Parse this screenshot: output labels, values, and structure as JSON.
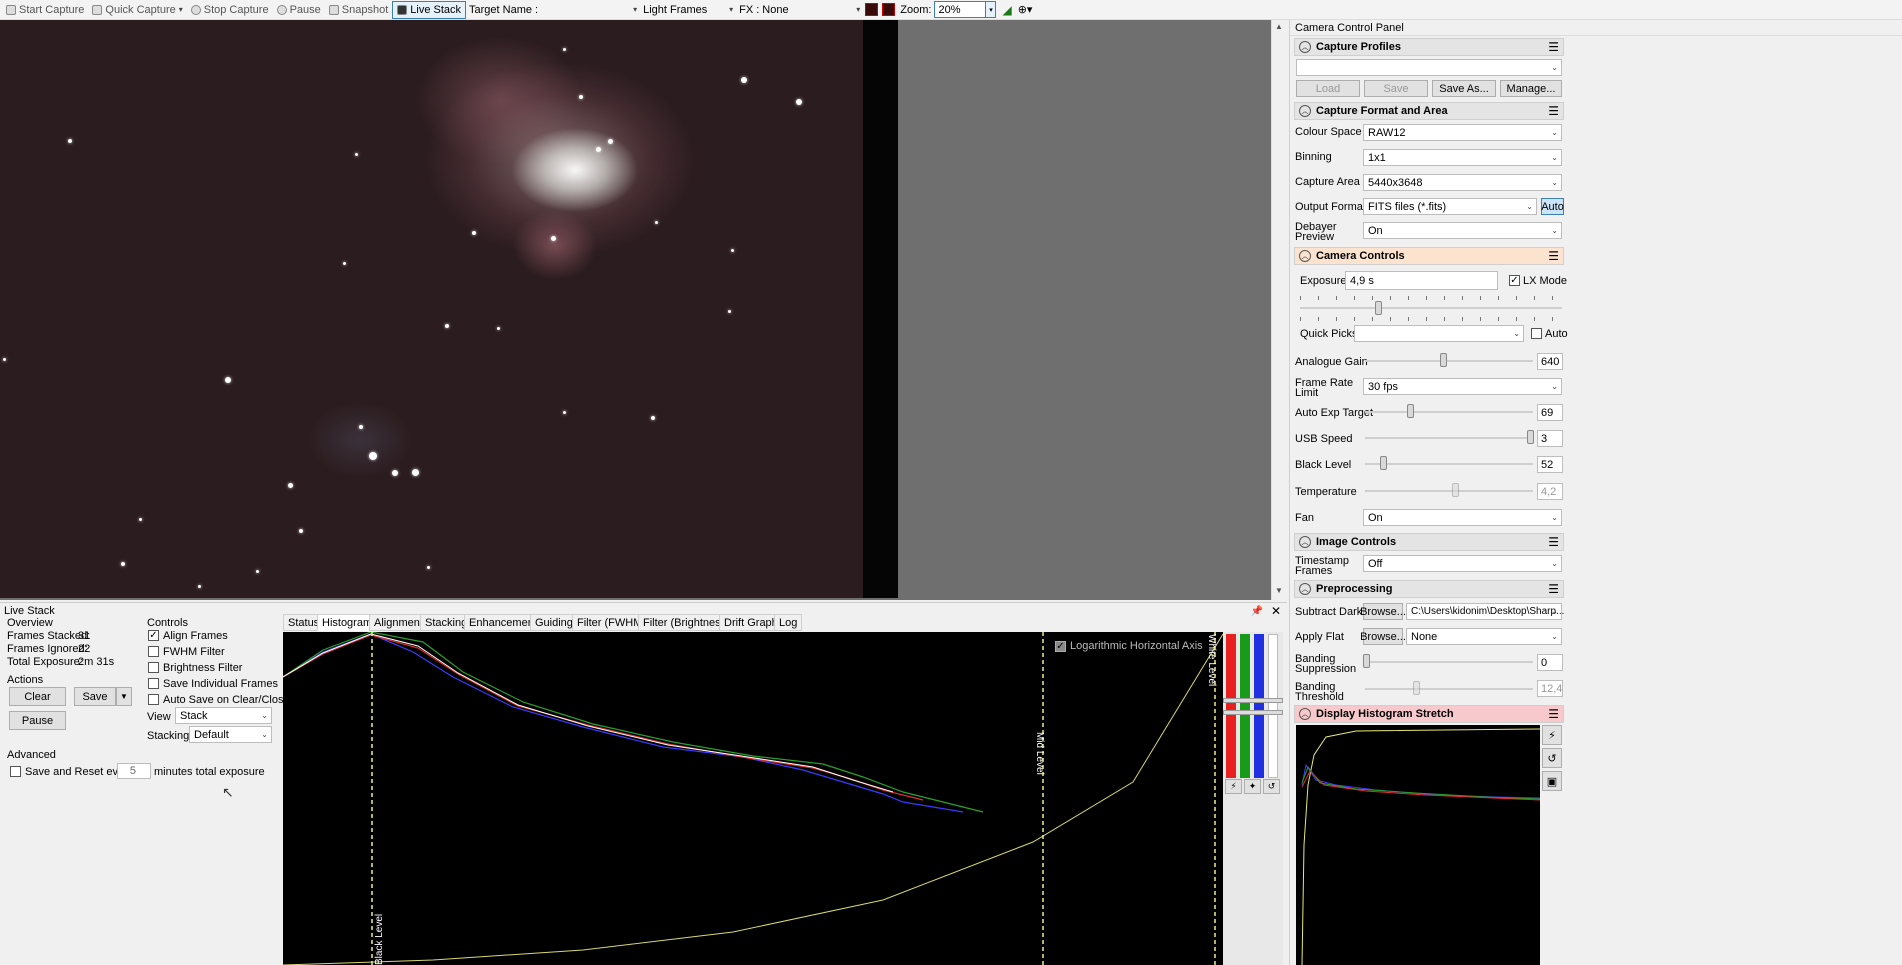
{
  "toolbar": {
    "start_capture": "Start Capture",
    "quick_capture": "Quick Capture",
    "stop_capture": "Stop Capture",
    "pause": "Pause",
    "snapshot": "Snapshot",
    "live_stack": "Live Stack",
    "target_name_label": "Target Name :",
    "frame_type": "Light Frames",
    "fx_label": "FX :",
    "fx_value": "None",
    "zoom_label": "Zoom:",
    "zoom_value": "20%"
  },
  "panel": {
    "title": "Camera Control Panel",
    "capture_profiles": {
      "header": "Capture Profiles",
      "load": "Load",
      "save": "Save",
      "save_as": "Save As...",
      "manage": "Manage..."
    },
    "capture_format": {
      "header": "Capture Format and Area",
      "colour_space_label": "Colour Space",
      "colour_space": "RAW12",
      "binning_label": "Binning",
      "binning": "1x1",
      "capture_area_label": "Capture Area",
      "capture_area": "5440x3648",
      "output_format_label": "Output Format",
      "output_format": "FITS files (*.fits)",
      "auto_button": "Auto",
      "debayer_label_1": "Debayer",
      "debayer_label_2": "Preview",
      "debayer": "On"
    },
    "camera_controls": {
      "header": "Camera Controls",
      "exposure_label": "Exposure",
      "exposure_value": "4,9 s",
      "lx_mode_label": "LX Mode",
      "lx_mode_checked": true,
      "quick_picks_label": "Quick Picks",
      "auto_label": "Auto",
      "analogue_gain_label": "Analogue Gain",
      "analogue_gain": "640",
      "frame_rate_label_1": "Frame Rate",
      "frame_rate_label_2": "Limit",
      "frame_rate": "30 fps",
      "auto_exp_label": "Auto Exp Target",
      "auto_exp": "69",
      "usb_speed_label": "USB Speed",
      "usb_speed": "3",
      "black_level_label": "Black Level",
      "black_level": "52",
      "temperature_label": "Temperature",
      "temperature": "4,2",
      "fan_label": "Fan",
      "fan": "On"
    },
    "image_controls": {
      "header": "Image Controls",
      "timestamp_label_1": "Timestamp",
      "timestamp_label_2": "Frames",
      "timestamp": "Off"
    },
    "preprocessing": {
      "header": "Preprocessing",
      "subtract_dark_label": "Subtract Dark",
      "browse": "Browse...",
      "dark_path": "C:\\Users\\kidonim\\Desktop\\Sharp...",
      "apply_flat_label": "Apply Flat",
      "flat_value": "None",
      "banding_suppression_label_1": "Banding",
      "banding_suppression_label_2": "Suppression",
      "banding_suppression": "0",
      "banding_threshold_label_1": "Banding",
      "banding_threshold_label_2": "Threshold",
      "banding_threshold": "12,4"
    },
    "display_histogram": {
      "header": "Display Histogram Stretch"
    }
  },
  "live_stack": {
    "title": "Live Stack",
    "overview_label": "Overview",
    "frames_stacked_label": "Frames Stacked:",
    "frames_stacked": "31",
    "frames_ignored_label": "Frames Ignored:",
    "frames_ignored": "22",
    "total_exposure_label": "Total Exposure:",
    "total_exposure": "2m 31s",
    "actions_label": "Actions",
    "clear": "Clear",
    "save": "Save",
    "pause": "Pause",
    "advanced_label": "Advanced",
    "save_reset_label": "Save and Reset every",
    "save_reset_value": "5",
    "minutes_label": "minutes total exposure",
    "controls_label": "Controls",
    "align_frames": "Align Frames",
    "fwhm_filter": "FWHM Filter",
    "brightness_filter": "Brightness Filter",
    "save_individual": "Save Individual Frames",
    "auto_save": "Auto Save on Clear/Close",
    "view_label": "View",
    "view_value": "Stack",
    "stacking_label": "Stacking",
    "stacking_value": "Default",
    "tabs": [
      "Status",
      "Histogram",
      "Alignment",
      "Stacking",
      "Enhancement",
      "Guiding",
      "Filter (FWHM)",
      "Filter (Brightness)",
      "Drift Graph",
      "Log"
    ],
    "active_tab": "Histogram",
    "histogram": {
      "log_axis_label": "Logarithmic Horizontal Axis",
      "black_level_marker": "Black Level",
      "mid_level_marker": "Mid Level",
      "white_level_marker": "White Level"
    }
  },
  "colors": {
    "accent": "#3c7fb1",
    "sky": "#2b1c1f",
    "display_hdr": "#f7c9cc",
    "camera_hdr": "#fbe3d0"
  }
}
